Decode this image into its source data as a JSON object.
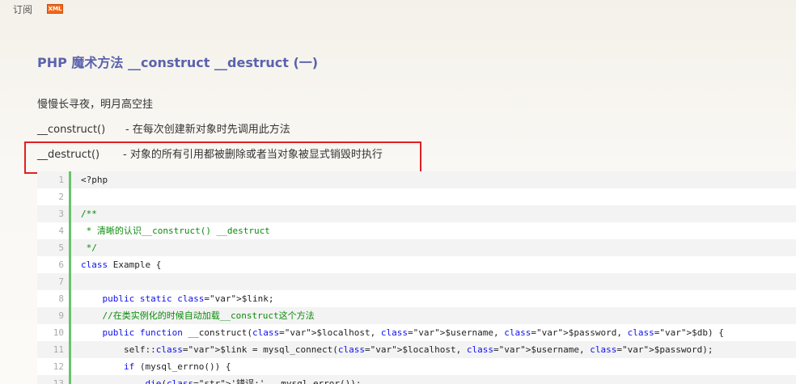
{
  "topbar": {
    "subscribe_label": "订阅",
    "xml_badge": "XML"
  },
  "post": {
    "title": "PHP 魔术方法 __construct __destruct (一)",
    "intro": "慢慢长寻夜，明月高空挂",
    "construct_line": "__construct()      - 在每次创建新对象时先调用此方法",
    "destruct_line": "__destruct()       - 对象的所有引用都被删除或者当对象被显式销毁时执行"
  },
  "code_block": {
    "lines": [
      {
        "n": "1",
        "text": "<?php"
      },
      {
        "n": "2",
        "text": ""
      },
      {
        "n": "3",
        "text": "/**"
      },
      {
        "n": "4",
        "text": " * 清晰的认识__construct() __destruct"
      },
      {
        "n": "5",
        "text": " */"
      },
      {
        "n": "6",
        "text": "class Example {"
      },
      {
        "n": "7",
        "text": ""
      },
      {
        "n": "8",
        "text": "    public static $link;"
      },
      {
        "n": "9",
        "text": "    //在类实例化的时候自动加载__construct这个方法"
      },
      {
        "n": "10",
        "text": "    public function __construct($localhost, $username, $password, $db) {"
      },
      {
        "n": "11",
        "text": "        self::$link = mysql_connect($localhost, $username, $password);"
      },
      {
        "n": "12",
        "text": "        if (mysql_errno()) {"
      },
      {
        "n": "13",
        "text": "            die('错误:' . mysql_error());"
      }
    ]
  },
  "colors": {
    "title": "#5a63ad",
    "highlight_border": "#e02020",
    "gutter_line": "#6ac36a"
  }
}
